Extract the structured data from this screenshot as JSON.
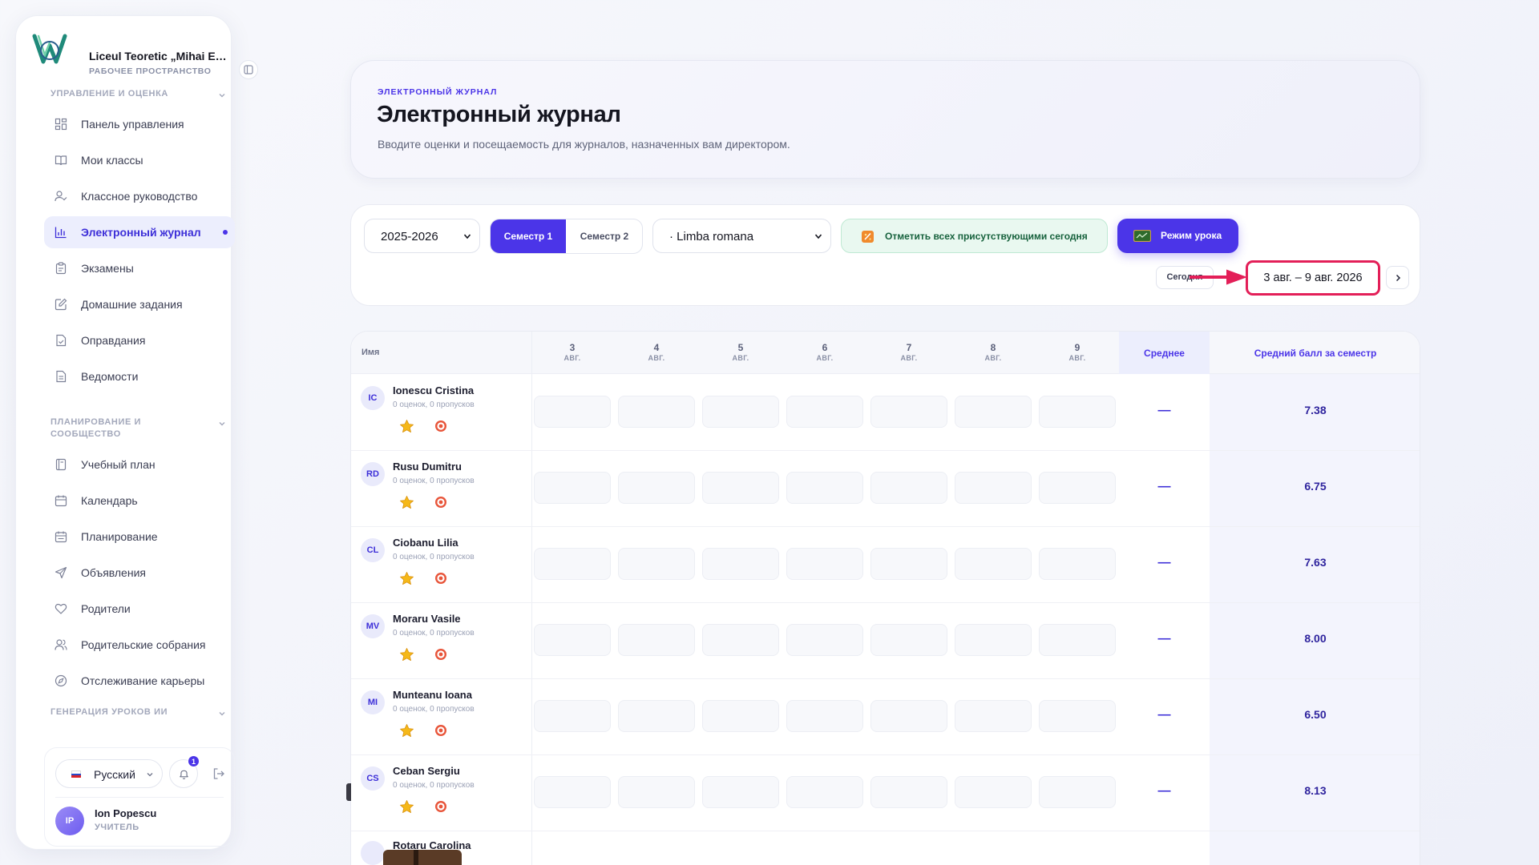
{
  "app": {
    "school_name": "Liceul Teoretic „Mihai Emi...",
    "workspace_label": "РАБОЧЕЕ ПРОСТРАНСТВО"
  },
  "sidebar": {
    "sections": [
      {
        "title": "УПРАВЛЕНИЕ И ОЦЕНКА"
      },
      {
        "title": "ПЛАНИРОВАНИЕ И СООБЩЕСТВО"
      },
      {
        "title": "ГЕНЕРАЦИЯ УРОКОВ ИИ"
      }
    ],
    "items": [
      {
        "label": "Панель управления",
        "icon": "dashboard-icon"
      },
      {
        "label": "Мои классы",
        "icon": "book-open-icon"
      },
      {
        "label": "Классное руководство",
        "icon": "user-check-icon"
      },
      {
        "label": "Электронный журнал",
        "icon": "bar-chart-icon",
        "active": true
      },
      {
        "label": "Экзамены",
        "icon": "clipboard-icon"
      },
      {
        "label": "Домашние задания",
        "icon": "edit-icon"
      },
      {
        "label": "Оправдания",
        "icon": "file-check-icon"
      },
      {
        "label": "Ведомости",
        "icon": "file-text-icon"
      },
      {
        "label": "Учебный план",
        "icon": "notebook-icon"
      },
      {
        "label": "Календарь",
        "icon": "calendar-icon"
      },
      {
        "label": "Планирование",
        "icon": "calendar-days-icon"
      },
      {
        "label": "Объявления",
        "icon": "send-icon"
      },
      {
        "label": "Родители",
        "icon": "heart-icon"
      },
      {
        "label": "Родительские собрания",
        "icon": "users-icon"
      },
      {
        "label": "Отслеживание карьеры",
        "icon": "compass-icon"
      }
    ],
    "footer": {
      "language": "Русский",
      "notifications_count": "1",
      "user_initials": "IP",
      "user_name": "Ion Popescu",
      "user_role": "УЧИТЕЛЬ"
    }
  },
  "header": {
    "eyebrow": "ЭЛЕКТРОННЫЙ ЖУРНАЛ",
    "title": "Электронный журнал",
    "subtitle": "Вводите оценки и посещаемость для журналов, назначенных вам директором."
  },
  "toolbar": {
    "year": "2025-2026",
    "semesters": [
      "Семестр 1",
      "Семестр 2"
    ],
    "active_semester": "Семестр 1",
    "subject": "· Limba romana",
    "mark_all_label": "Отметить всех присутствующими сегодня",
    "lesson_mode_label": "Режим урока",
    "today_label": "Сегодня",
    "date_range": "3 авг. – 9 авг. 2026"
  },
  "table": {
    "name_header": "Имя",
    "days": [
      {
        "day": "3",
        "month": "АВГ."
      },
      {
        "day": "4",
        "month": "АВГ."
      },
      {
        "day": "5",
        "month": "АВГ."
      },
      {
        "day": "6",
        "month": "АВГ."
      },
      {
        "day": "7",
        "month": "АВГ."
      },
      {
        "day": "8",
        "month": "АВГ."
      },
      {
        "day": "9",
        "month": "АВГ."
      }
    ],
    "avg_header": "Среднее",
    "semester_avg_header": "Средний балл за семестр",
    "rows": [
      {
        "initials": "IC",
        "name": "Ionescu Cristina",
        "meta": "0 оценок, 0 пропусков",
        "avg": "—",
        "semester_avg": "7.38"
      },
      {
        "initials": "RD",
        "name": "Rusu Dumitru",
        "meta": "0 оценок, 0 пропусков",
        "avg": "—",
        "semester_avg": "6.75"
      },
      {
        "initials": "CL",
        "name": "Ciobanu Lilia",
        "meta": "0 оценок, 0 пропусков",
        "avg": "—",
        "semester_avg": "7.63"
      },
      {
        "initials": "MV",
        "name": "Moraru Vasile",
        "meta": "0 оценок, 0 пропусков",
        "avg": "—",
        "semester_avg": "8.00"
      },
      {
        "initials": "MI",
        "name": "Munteanu Ioana",
        "meta": "0 оценок, 0 пропусков",
        "avg": "—",
        "semester_avg": "6.50"
      },
      {
        "initials": "CS",
        "name": "Ceban Sergiu",
        "meta": "0 оценок, 0 пропусков",
        "avg": "—",
        "semester_avg": "8.13"
      }
    ],
    "partial_row_name": "Rotaru Carolina"
  },
  "colors": {
    "accent": "#4b35e8",
    "highlight_annotation": "#e31f58",
    "attendance_green": "#17623d"
  }
}
